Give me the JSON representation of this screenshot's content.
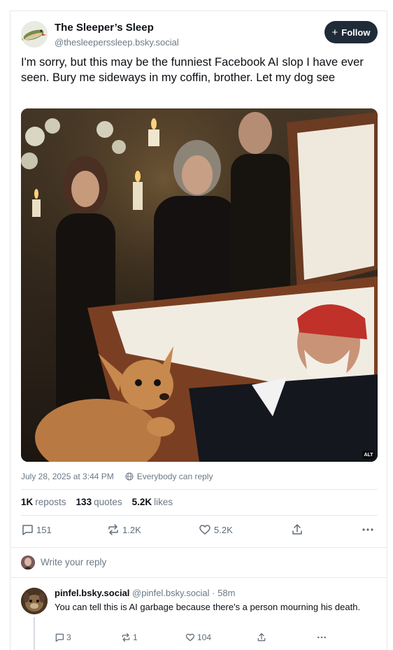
{
  "author": {
    "display_name": "The Sleeper’s Sleep",
    "handle": "@thesleeperssleep.bsky.social",
    "avatar_icon": "fish-avatar"
  },
  "follow_button": {
    "icon": "plus-icon",
    "label": "Follow"
  },
  "post": {
    "text": "I'm sorry, but this may be the funniest Facebook AI slop I have ever seen. Bury me sideways in my coffin, brother. Let my dog see",
    "alt_badge": "ALT",
    "timestamp": "July 28, 2025 at 3:44 PM",
    "reply_setting": "Everybody can reply"
  },
  "stats": {
    "reposts_count": "1K",
    "reposts_label": "reposts",
    "quotes_count": "133",
    "quotes_label": "quotes",
    "likes_count": "5.2K",
    "likes_label": "likes"
  },
  "actions": {
    "reply_count": "151",
    "repost_count": "1.2K",
    "like_count": "5.2K"
  },
  "reply_composer": {
    "placeholder": "Write your reply"
  },
  "comment": {
    "display_name": "pinfel.bsky.social",
    "handle": "@pinfel.bsky.social",
    "time": "· 58m",
    "text": "You can tell this is AI garbage because there's a person mourning his death.",
    "reply_count": "3",
    "repost_count": "1",
    "like_count": "104"
  },
  "colors": {
    "follow_bg": "#1f2b38",
    "muted_text": "#6b7886",
    "border": "#e4e8ee"
  }
}
